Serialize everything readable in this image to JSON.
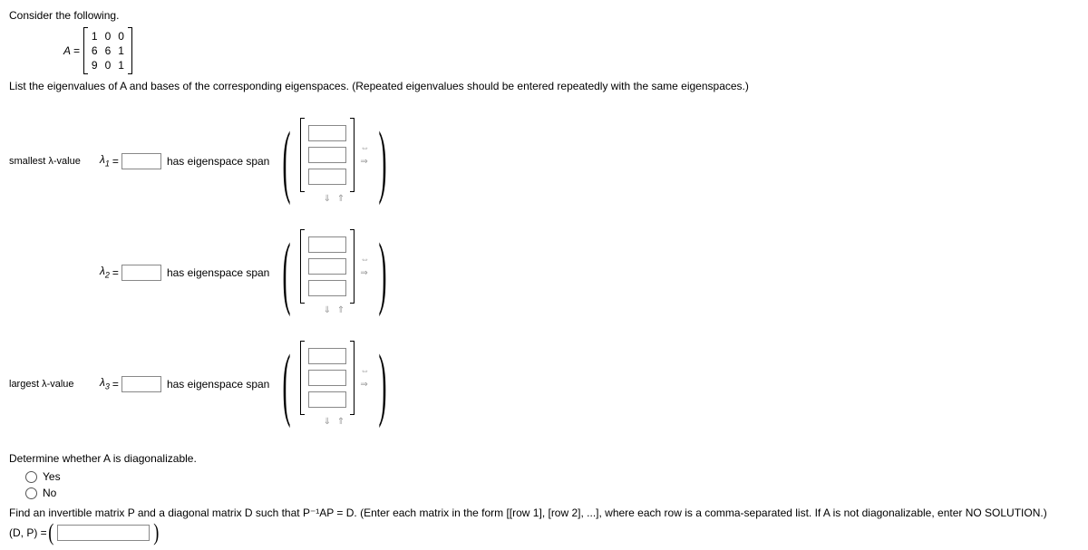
{
  "intro": "Consider the following.",
  "matrix": {
    "label": "A =",
    "rows": [
      [
        "1",
        "0",
        "0"
      ],
      [
        "6",
        "6",
        "1"
      ],
      [
        "9",
        "0",
        "1"
      ]
    ]
  },
  "instruction": "List the eigenvalues of A and bases of the corresponding eigenspaces. (Repeated eigenvalues should be entered repeatedly with the same eigenspaces.)",
  "eigen": [
    {
      "prelabel": "smallest λ-value",
      "lambda": "λ",
      "sub": "1",
      "eq": "=",
      "after": "has eigenspace span"
    },
    {
      "prelabel": "",
      "lambda": "λ",
      "sub": "2",
      "eq": "=",
      "after": "has eigenspace span"
    },
    {
      "prelabel": "largest λ-value",
      "lambda": "λ",
      "sub": "3",
      "eq": "=",
      "after": "has eigenspace span"
    }
  ],
  "diag": {
    "question": "Determine whether A is diagonalizable.",
    "yes": "Yes",
    "no": "No"
  },
  "final": {
    "text": "Find an invertible matrix P and a diagonal matrix D such that P⁻¹AP = D. (Enter each matrix in the form [[row 1], [row 2], ...], where each row is a comma-separated list. If A is not diagonalizable, enter NO SOLUTION.)",
    "label": "(D, P) ="
  },
  "arrows": {
    "h1": "⇔",
    "h2": "⇒",
    "v": "⇓ ⇑"
  }
}
